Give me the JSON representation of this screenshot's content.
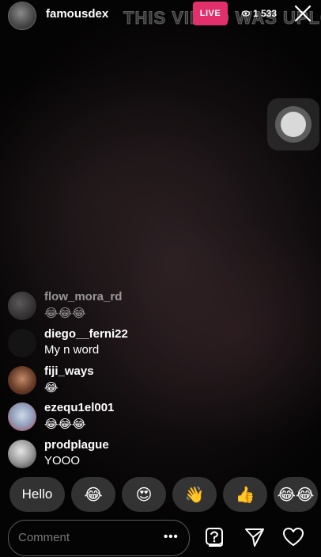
{
  "header": {
    "username": "famousdex",
    "live_label": "LIVE",
    "viewer_count": "1 533",
    "watermark": "THIS VIDEO WAS UPLOA"
  },
  "comments": [
    {
      "user": "flow_mora_rd",
      "message": "😂😂😂",
      "faded": true
    },
    {
      "user": "diego__ferni22",
      "message": "My n word"
    },
    {
      "user": "fiji_ways",
      "message": "😂"
    },
    {
      "user": "ezequ1el001",
      "message": "😂😂😂"
    },
    {
      "user": "prodplague",
      "message": "YOOO"
    }
  ],
  "quick_replies": [
    "Hello",
    "😂",
    "😍",
    "👋",
    "👍",
    "😂😂"
  ],
  "composer": {
    "placeholder": "Comment",
    "more_label": "•••"
  },
  "colors": {
    "live_badge": "#e1306c"
  }
}
